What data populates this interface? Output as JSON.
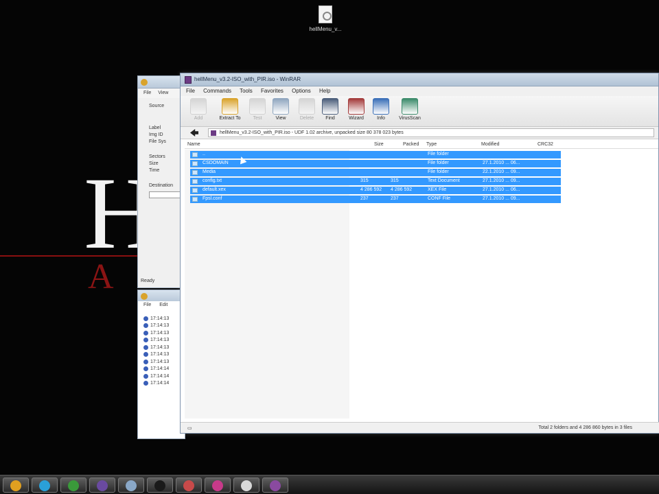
{
  "desktop": {
    "icon_label": "hellMenu_v..."
  },
  "wallpaper": {
    "letter": "H",
    "subtitle": "A"
  },
  "back_window_1": {
    "menu": [
      "File",
      "View"
    ],
    "fields": [
      "Source",
      "Label",
      "Img ID",
      "File Sys",
      "Sectors",
      "Size",
      "Time",
      "Destination"
    ],
    "status": "Ready"
  },
  "back_window_2": {
    "menu": [
      "File",
      "Edit"
    ],
    "log": [
      "17:14:13",
      "17:14:13",
      "17:14:13",
      "17:14:13",
      "17:14:13",
      "17:14:13",
      "17:14:13",
      "17:14:14",
      "17:14:14",
      "17:14:14"
    ]
  },
  "main_window": {
    "title": "hellMenu_v3.2-ISO_with_PIR.iso - WinRAR",
    "menu": [
      "File",
      "Commands",
      "Tools",
      "Favorites",
      "Options",
      "Help"
    ],
    "toolbar": [
      {
        "label": "Add",
        "icon": "add-icon",
        "enabled": false,
        "color": "#b0b0b0"
      },
      {
        "label": "Extract To",
        "icon": "extract-icon",
        "enabled": true,
        "color": "#d9a32c"
      },
      {
        "label": "Test",
        "icon": "test-icon",
        "enabled": false,
        "color": "#b0b0b0"
      },
      {
        "label": "View",
        "icon": "view-icon",
        "enabled": true,
        "color": "#8fa6bf"
      },
      {
        "label": "Delete",
        "icon": "delete-icon",
        "enabled": false,
        "color": "#b0b0b0"
      },
      {
        "label": "Find",
        "icon": "find-icon",
        "enabled": true,
        "color": "#4a5d7a"
      },
      {
        "label": "Wizard",
        "icon": "wizard-icon",
        "enabled": true,
        "color": "#a33a3a"
      },
      {
        "label": "Info",
        "icon": "info-icon",
        "enabled": true,
        "color": "#3a6fb8"
      },
      {
        "label": "VirusScan",
        "icon": "virusscan-icon",
        "enabled": true,
        "color": "#3a8a6a"
      }
    ],
    "address": "hellMenu_v3.2-ISO_with_PIR.iso - UDF 1.02 archive, unpacked size 80 378 023 bytes",
    "columns": [
      "Name",
      "Size",
      "Packed",
      "Type",
      "Modified",
      "CRC32"
    ],
    "rows": [
      {
        "name": "..",
        "size": "",
        "packed": "",
        "type": "File folder",
        "modified": ""
      },
      {
        "name": "CSDOMAIN",
        "size": "",
        "packed": "",
        "type": "File folder",
        "modified": "27.1.2010 ... 06..."
      },
      {
        "name": "Media",
        "size": "",
        "packed": "",
        "type": "File folder",
        "modified": "22.1.2010 ... 09..."
      },
      {
        "name": "config.txt",
        "size": "315",
        "packed": "315",
        "type": "Text Document",
        "modified": "27.1.2010 ... 09..."
      },
      {
        "name": "default.xex",
        "size": "4 286 592",
        "packed": "4 286 592",
        "type": "XEX File",
        "modified": "27.1.2010 ... 06..."
      },
      {
        "name": "Fpsl.conf",
        "size": "237",
        "packed": "237",
        "type": "CONF File",
        "modified": "27.1.2010 ... 09..."
      }
    ],
    "status_right": "Total 2 folders and 4 286 860 bytes in 3 files"
  },
  "taskbar": {
    "items": [
      {
        "icon": "chrome-icon",
        "color": "#e0a020"
      },
      {
        "icon": "skype-icon",
        "color": "#2aa0d8"
      },
      {
        "icon": "utorrent-icon",
        "color": "#3a9a3a"
      },
      {
        "icon": "premiere-icon",
        "color": "#6a4aa0"
      },
      {
        "icon": "folder-icon",
        "color": "#8aa8c8"
      },
      {
        "icon": "console-icon",
        "color": "#1a1a1a"
      },
      {
        "icon": "app-icon",
        "color": "#c84a4a"
      },
      {
        "icon": "media-icon",
        "color": "#c83a8a"
      },
      {
        "icon": "disc-icon",
        "color": "#d8d8d8"
      },
      {
        "icon": "winrar-icon",
        "color": "#8a4aa0"
      }
    ]
  }
}
